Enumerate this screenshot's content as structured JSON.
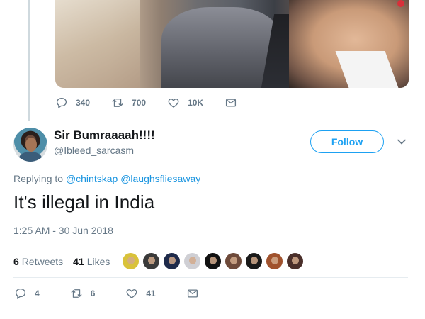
{
  "parent_tweet": {
    "actions": {
      "replies": "340",
      "retweets": "700",
      "likes": "10K"
    }
  },
  "tweet": {
    "display_name": "Sir Bumraaaah!!!!",
    "handle": "@Ibleed_sarcasm",
    "follow_label": "Follow",
    "replying_prefix": "Replying to",
    "mentions": [
      "@chintskap",
      "@laughsfliesaway"
    ],
    "text": "It's illegal in India",
    "timestamp": "1:25 AM - 30 Jun 2018",
    "stats": {
      "retweets_count": "6",
      "retweets_label": "Retweets",
      "likes_count": "41",
      "likes_label": "Likes"
    },
    "liker_avatars": [
      {
        "color": "#d9c23a"
      },
      {
        "color": "#3a3a3a"
      },
      {
        "color": "#1e2a4a"
      },
      {
        "color": "#cfcfd4"
      },
      {
        "color": "#111111"
      },
      {
        "color": "#6e4a3a"
      },
      {
        "color": "#1a1a1a"
      },
      {
        "color": "#a0522d"
      },
      {
        "color": "#4a2f2a"
      }
    ],
    "actions": {
      "replies": "4",
      "retweets": "6",
      "likes": "41"
    }
  },
  "colors": {
    "accent": "#1da1f2",
    "link": "#1b95e0",
    "muted": "#657786"
  }
}
